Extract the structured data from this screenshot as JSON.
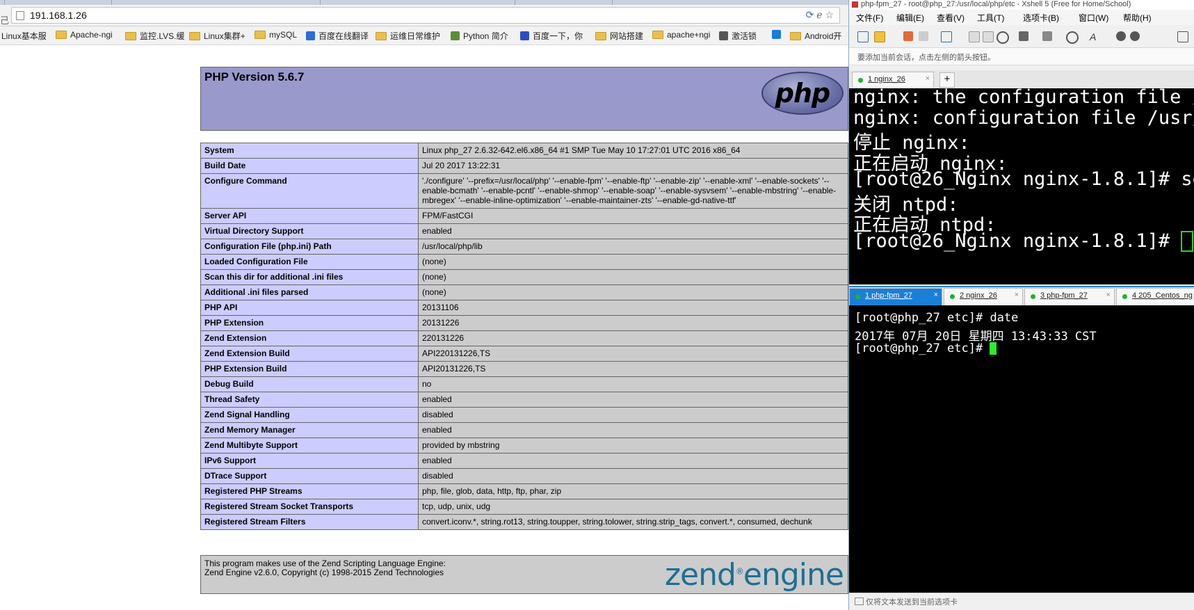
{
  "browser": {
    "url": "191.168.1.26",
    "left_edge_char": "己",
    "bookmarks": [
      {
        "label": "Linux基本服",
        "icon": "none"
      },
      {
        "label": "Apache-ngi",
        "icon": "folder-icon"
      },
      {
        "label": "监控.LVS.缓",
        "icon": "folder-icon"
      },
      {
        "label": "Linux集群+",
        "icon": "folder-icon"
      },
      {
        "label": "mySQL",
        "icon": "folder-icon"
      },
      {
        "label": "百度在线翻译",
        "icon": "translate-icon"
      },
      {
        "label": "运维日常维护",
        "icon": "folder-icon"
      },
      {
        "label": "Python 简介",
        "icon": "python-icon"
      },
      {
        "label": "百度一下，你",
        "icon": "baidu-icon"
      },
      {
        "label": "网站搭建",
        "icon": "folder-icon"
      },
      {
        "label": "apache+ngi",
        "icon": "folder-icon"
      },
      {
        "label": "激活锁",
        "icon": "apple-icon"
      },
      {
        "label": "",
        "icon": "app-icon"
      },
      {
        "label": "Android开",
        "icon": "folder-icon"
      }
    ]
  },
  "phpinfo": {
    "title": "PHP Version 5.6.7",
    "logo_text": "php",
    "rows": [
      {
        "key": "System",
        "value": "Linux php_27 2.6.32-642.el6.x86_64 #1 SMP Tue May 10 17:27:01 UTC 2016 x86_64"
      },
      {
        "key": "Build Date",
        "value": "Jul 20 2017 13:22:31"
      },
      {
        "key": "Configure Command",
        "value": "'./configure' '--prefix=/usr/local/php' '--enable-fpm' '--enable-ftp' '--enable-zip' '--enable-xml' '--enable-sockets' '--enable-bcmath' '--enable-pcntl' '--enable-shmop' '--enable-soap' '--enable-sysvsem' '--enable-mbstring' '--enable-mbregex' '--enable-inline-optimization' '--enable-maintainer-zts' '--enable-gd-native-ttf'"
      },
      {
        "key": "Server API",
        "value": "FPM/FastCGI"
      },
      {
        "key": "Virtual Directory Support",
        "value": "enabled"
      },
      {
        "key": "Configuration File (php.ini) Path",
        "value": "/usr/local/php/lib"
      },
      {
        "key": "Loaded Configuration File",
        "value": "(none)"
      },
      {
        "key": "Scan this dir for additional .ini files",
        "value": "(none)"
      },
      {
        "key": "Additional .ini files parsed",
        "value": "(none)"
      },
      {
        "key": "PHP API",
        "value": "20131106"
      },
      {
        "key": "PHP Extension",
        "value": "20131226"
      },
      {
        "key": "Zend Extension",
        "value": "220131226"
      },
      {
        "key": "Zend Extension Build",
        "value": "API220131226,TS"
      },
      {
        "key": "PHP Extension Build",
        "value": "API20131226,TS"
      },
      {
        "key": "Debug Build",
        "value": "no"
      },
      {
        "key": "Thread Safety",
        "value": "enabled"
      },
      {
        "key": "Zend Signal Handling",
        "value": "disabled"
      },
      {
        "key": "Zend Memory Manager",
        "value": "enabled"
      },
      {
        "key": "Zend Multibyte Support",
        "value": "provided by mbstring"
      },
      {
        "key": "IPv6 Support",
        "value": "enabled"
      },
      {
        "key": "DTrace Support",
        "value": "disabled"
      },
      {
        "key": "Registered PHP Streams",
        "value": "php, file, glob, data, http, ftp, phar, zip"
      },
      {
        "key": "Registered Stream Socket Transports",
        "value": "tcp, udp, unix, udg"
      },
      {
        "key": "Registered Stream Filters",
        "value": "convert.iconv.*, string.rot13, string.toupper, string.tolower, string.strip_tags, convert.*, consumed, dechunk"
      }
    ],
    "zend_line1": "This program makes use of the Zend Scripting Language Engine:",
    "zend_line2": "Zend Engine v2.6.0, Copyright (c) 1998-2015 Zend Technologies",
    "zend_logo": "zend",
    "zend_logo_tail": "engine"
  },
  "xshell": {
    "title": "php-fpm_27 - root@php_27:/usr/local/php/etc - Xshell 5 (Free for Home/School)",
    "menu": [
      "文件(F)",
      "编辑(E)",
      "查看(V)",
      "工具(T)",
      "选项卡(B)",
      "窗口(W)",
      "帮助(H)"
    ],
    "hint": "要添加当前会话，点击左侧的箭头按钮。",
    "top_tabs": [
      {
        "label": "1 nginx_26"
      }
    ],
    "top_plus": "+",
    "term1_lines": [
      "nginx: the configuration file /",
      "nginx: configuration file /usr/",
      "停止 nginx:",
      "正在启动 nginx:",
      "[root@26_Nginx nginx-1.8.1]# se",
      "关闭 ntpd:",
      "正在启动 ntpd:",
      "[root@26_Nginx nginx-1.8.1]# "
    ],
    "bottom_tabs": [
      {
        "label": "1 php-fpm_27"
      },
      {
        "label": "2 nginx_26"
      },
      {
        "label": "3 php-fpm_27"
      },
      {
        "label": "4 205_Centos_ng"
      }
    ],
    "close_glyph": "×",
    "term2_lines": [
      "[root@php_27 etc]# date",
      "2017年 07月 20日 星期四 13:43:33 CST",
      "[root@php_27 etc]# "
    ],
    "send_bar": "仅将文本发送到当前选项卡"
  }
}
